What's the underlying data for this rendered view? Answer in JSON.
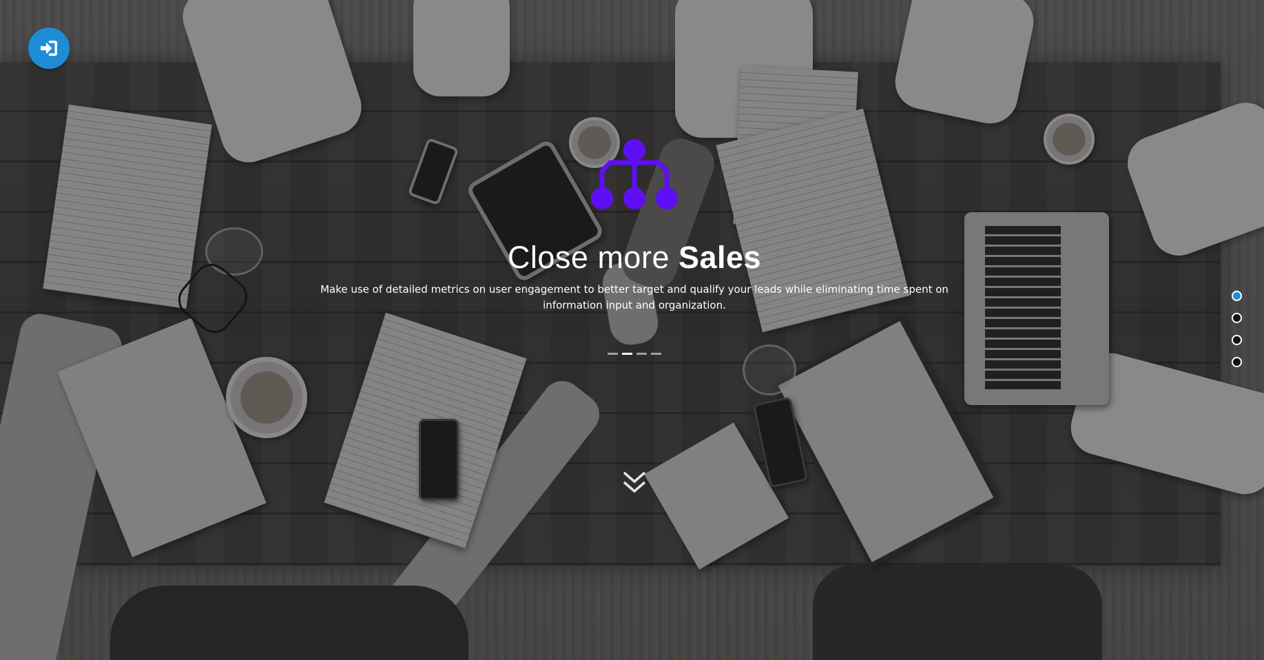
{
  "login": {
    "icon": "sign-in-icon",
    "accent_color": "#1f8dd6"
  },
  "feature_icon": {
    "icon": "sitemap-icon",
    "color": "#5e0ff5"
  },
  "headline": {
    "light_text": "Close more",
    "bold_text": "Sales"
  },
  "description": "Make use of detailed metrics on user engagement to better target and qualify your leads while eliminating time spent on information input and organization.",
  "carousel": {
    "slide_count": 4,
    "active_index": 1
  },
  "scroll_down": {
    "icon": "double-chevron-down-icon"
  },
  "section_nav": {
    "count": 4,
    "active_index": 0,
    "active_color": "#1f8dd6"
  }
}
